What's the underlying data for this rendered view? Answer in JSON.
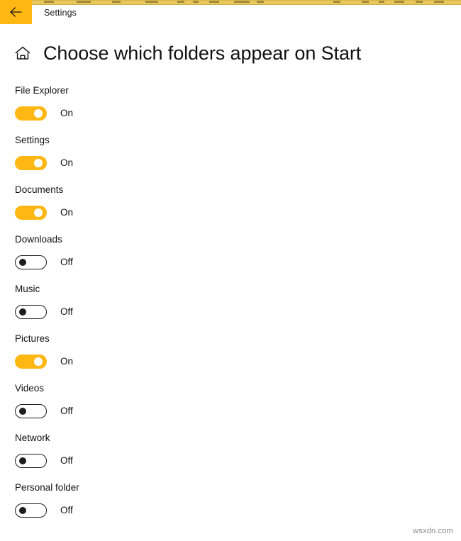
{
  "window": {
    "back_button_icon": "back-arrow-icon",
    "titlebar_title": "Settings"
  },
  "header": {
    "home_icon": "home-icon",
    "title": "Choose which folders appear on Start"
  },
  "accent_color": "#ffb813",
  "folders": [
    {
      "label": "File Explorer",
      "state": "On",
      "on": true
    },
    {
      "label": "Settings",
      "state": "On",
      "on": true
    },
    {
      "label": "Documents",
      "state": "On",
      "on": true
    },
    {
      "label": "Downloads",
      "state": "Off",
      "on": false
    },
    {
      "label": "Music",
      "state": "Off",
      "on": false
    },
    {
      "label": "Pictures",
      "state": "On",
      "on": true
    },
    {
      "label": "Videos",
      "state": "Off",
      "on": false
    },
    {
      "label": "Network",
      "state": "Off",
      "on": false
    },
    {
      "label": "Personal folder",
      "state": "Off",
      "on": false
    }
  ],
  "watermark": "wsxdn.com"
}
